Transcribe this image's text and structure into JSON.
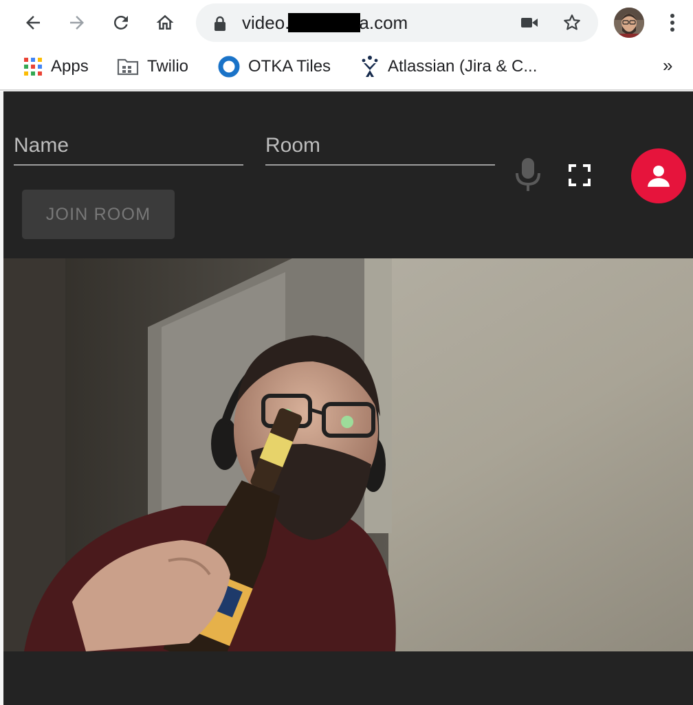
{
  "browser": {
    "url_prefix": "video.",
    "url_suffix": "a.com",
    "icons": {
      "back": "arrow-back-icon",
      "forward": "arrow-forward-icon",
      "reload": "reload-icon",
      "home": "home-icon",
      "lock": "lock-icon",
      "camera": "video-camera-icon",
      "bookmark_star": "star-icon",
      "menu": "kebab-menu-icon"
    }
  },
  "bookmarks": [
    {
      "label": "Apps",
      "icon": "apps-grid-icon"
    },
    {
      "label": "Twilio",
      "icon": "folder-icon"
    },
    {
      "label": "OTKA Tiles",
      "icon": "ring-icon"
    },
    {
      "label": "Atlassian (Jira & C...",
      "icon": "atlassian-icon"
    }
  ],
  "bookmarks_more": "»",
  "app": {
    "name_placeholder": "Name",
    "room_placeholder": "Room",
    "join_label": "JOIN ROOM",
    "colors": {
      "background": "#232323",
      "fab": "#e6143c",
      "button_disabled": "#3b3b3b"
    }
  }
}
